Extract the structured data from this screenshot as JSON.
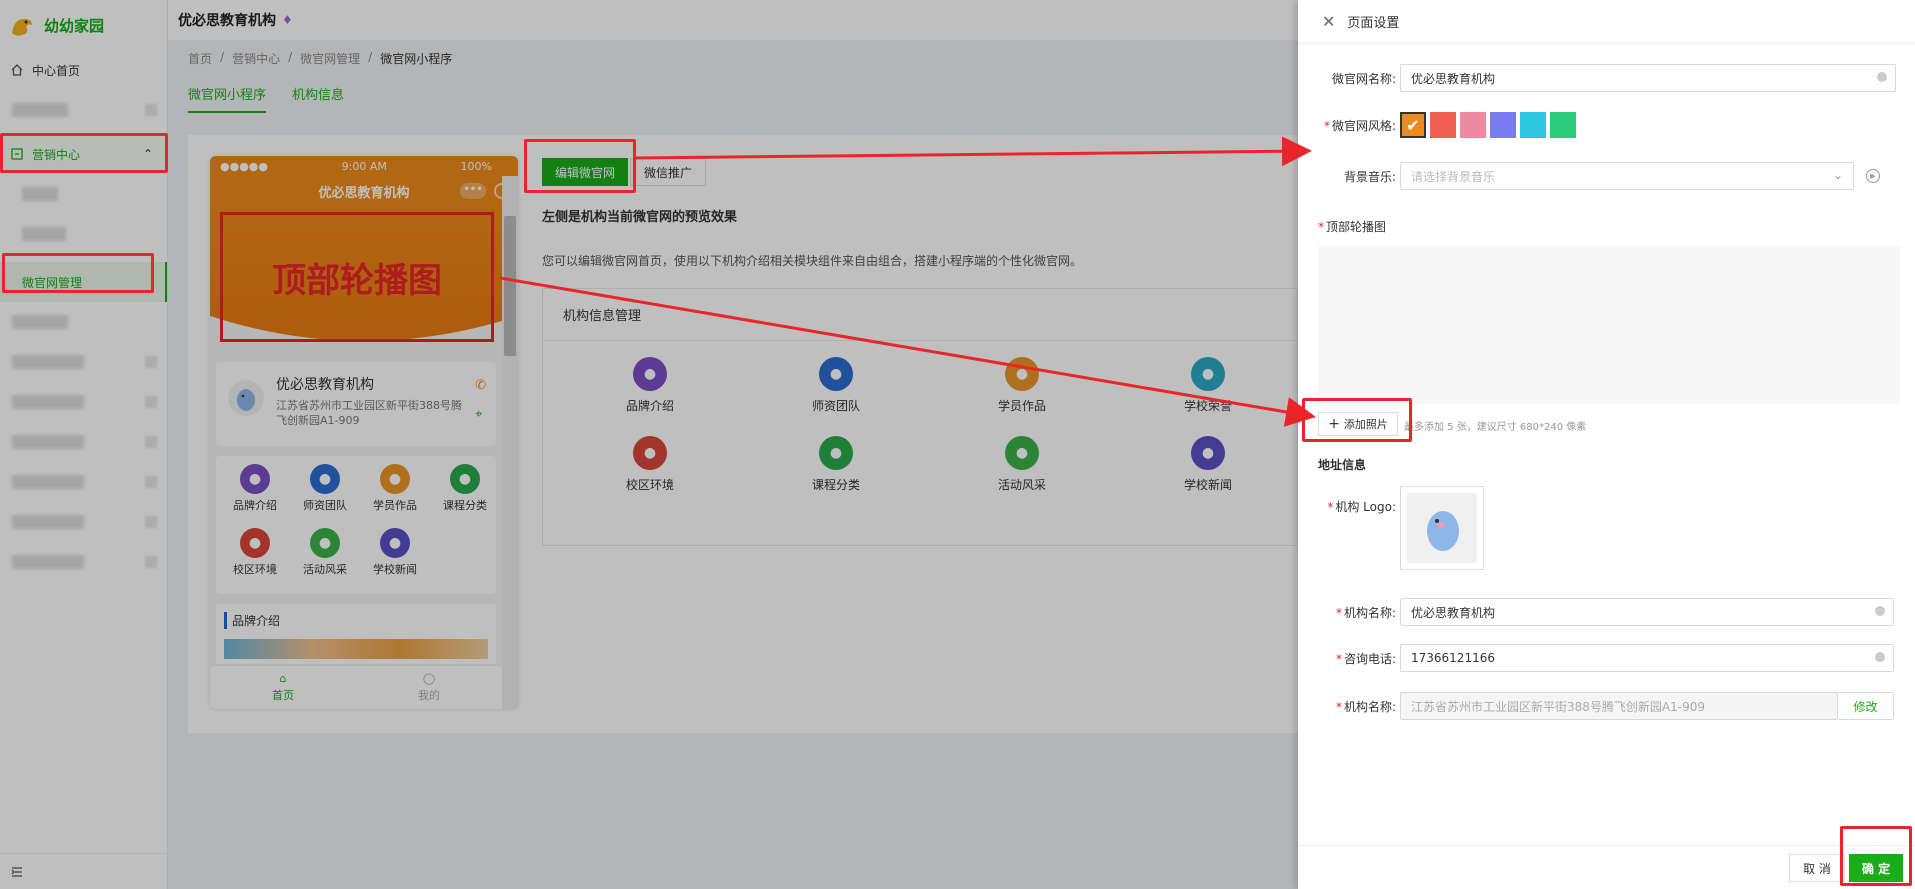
{
  "app": {
    "name": "幼幼家园",
    "title": "优必思教育机构",
    "brand_color": "#1aad19",
    "accent": "#e8262a"
  },
  "sidebar": {
    "home": "中心首页",
    "marketing": "营销中心",
    "active_sub": "微官网管理"
  },
  "breadcrumb": [
    "首页",
    "营销中心",
    "微官网管理",
    "微官网小程序"
  ],
  "tabs": [
    "微官网小程序",
    "机构信息"
  ],
  "phone": {
    "status_time": "9:00 AM",
    "status_signal": "●●●●● ",
    "status_battery": "100%",
    "nav_title": "优必思教育机构",
    "nav_dots": "•••",
    "banner_label": "顶部轮播图",
    "org_name": "优必思教育机构",
    "org_addr": "江苏省苏州市工业园区新平街388号腾飞创新园A1-909",
    "grid": [
      {
        "label": "品牌介绍",
        "color": "#7b4fc4"
      },
      {
        "label": "师资团队",
        "color": "#2d6bd1"
      },
      {
        "label": "学员作品",
        "color": "#e8962a"
      },
      {
        "label": "课程分类",
        "color": "#2aa84a"
      },
      {
        "label": "校区环境",
        "color": "#d9463b"
      },
      {
        "label": "活动风采",
        "color": "#3cb04a"
      },
      {
        "label": "学校新闻",
        "color": "#5b4fc4"
      }
    ],
    "section_title": "品牌介绍",
    "tabbar": [
      "首页",
      "我的"
    ]
  },
  "content": {
    "edit_button": "编辑微官网",
    "promo_button": "微信推广",
    "preview_title": "左侧是机构当前微官网的预览效果",
    "preview_desc": "您可以编辑微官网首页，使用以下机构介绍相关模块组件来自由组合，搭建小程序端的个性化微官网。",
    "mgmt_title": "机构信息管理",
    "mgmt_items": [
      {
        "label": "品牌介绍",
        "color": "#7b4fc4"
      },
      {
        "label": "师资团队",
        "color": "#2d6bd1"
      },
      {
        "label": "学员作品",
        "color": "#e8962a"
      },
      {
        "label": "学校荣誉",
        "color": "#2aa8c4"
      },
      {
        "label": "校区环境",
        "color": "#d9463b"
      },
      {
        "label": "课程分类",
        "color": "#2aa84a"
      },
      {
        "label": "活动风采",
        "color": "#3cb04a"
      },
      {
        "label": "学校新闻",
        "color": "#5b4fc4"
      }
    ]
  },
  "drawer": {
    "title": "页面设置",
    "site_name_label": "微官网名称:",
    "site_name_value": "优必思教育机构",
    "style_label": "微官网风格:",
    "style_colors": [
      "#ee8a1a",
      "#f06050",
      "#f08aa0",
      "#7a7af0",
      "#2ac8e0",
      "#2acc7a"
    ],
    "music_label": "背景音乐:",
    "music_placeholder": "请选择背景音乐",
    "carousel_label": "顶部轮播图",
    "add_photo": "添加照片",
    "upload_hint": "最多添加 5 张，建议尺寸 680*240 像素",
    "address_section": "地址信息",
    "logo_label": "机构 Logo:",
    "org_name_label": "机构名称:",
    "org_name_value": "优必思教育机构",
    "phone_label": "咨询电话:",
    "phone_value": "17366121166",
    "addr_label": "机构名称:",
    "addr_value": "江苏省苏州市工业园区新平街388号腾飞创新园A1-909",
    "modify": "修改",
    "cancel": "取 消",
    "ok": "确 定"
  }
}
